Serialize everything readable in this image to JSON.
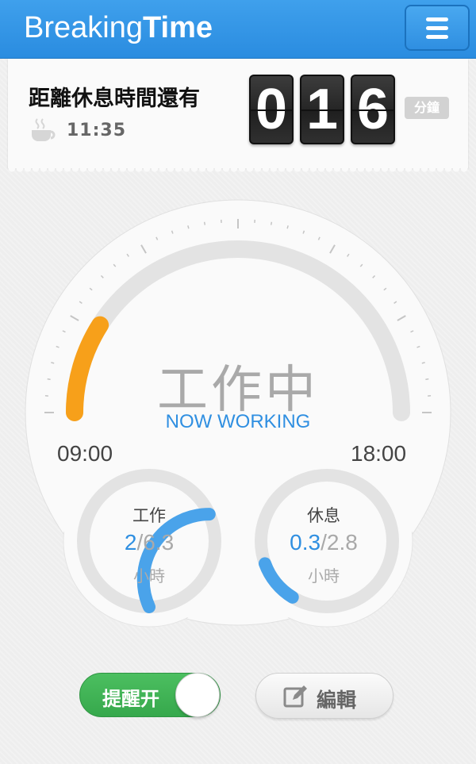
{
  "header": {
    "brand_light": "Breaking",
    "brand_bold": "Time",
    "menu_icon": "hamburger-menu-icon"
  },
  "countdown": {
    "title": "距離休息時間還有",
    "time": "11:35",
    "digits": [
      "0",
      "1",
      "6"
    ],
    "unit": "分鐘",
    "icon": "coffee-cup-icon"
  },
  "dial": {
    "status": "工作中",
    "status_en": "NOW WORKING",
    "start_time": "09:00",
    "end_time": "18:00",
    "progress_fraction": 0.18,
    "colors": {
      "progress": "#f7a01a",
      "track": "#e3e3e3",
      "ticks": "#c5c5c5"
    }
  },
  "gauges": {
    "work": {
      "label": "工作",
      "current": "2",
      "total": "/6.3",
      "unit": "小時",
      "fraction": 0.317
    },
    "rest": {
      "label": "休息",
      "current": "0.3",
      "total": "/2.8",
      "unit": "小時",
      "fraction": 0.107
    },
    "color": "#4aa3ea"
  },
  "controls": {
    "toggle_label": "提醒开",
    "toggle_on": true,
    "edit_label": "編輯",
    "edit_icon": "edit-pencil-icon"
  }
}
